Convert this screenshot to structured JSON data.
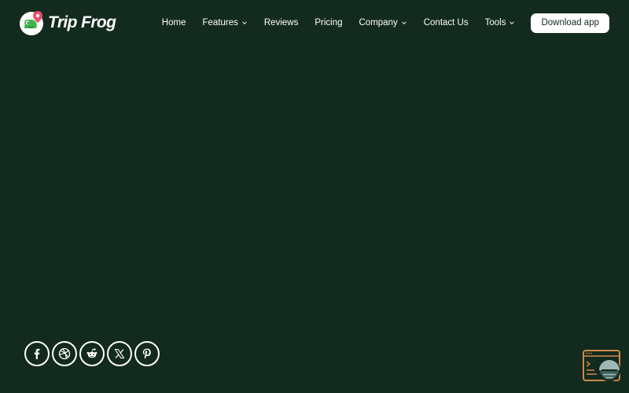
{
  "brand": {
    "name": "Trip Frog",
    "logo_icon": "frog-map-pin-icon",
    "accent_pin": "#e8506b",
    "frog_green": "#3bb54a"
  },
  "nav": {
    "items": [
      {
        "label": "Home",
        "has_dropdown": false
      },
      {
        "label": "Features",
        "has_dropdown": true,
        "icon": "chevron-down-icon"
      },
      {
        "label": "Reviews",
        "has_dropdown": false
      },
      {
        "label": "Pricing",
        "has_dropdown": false
      },
      {
        "label": "Company",
        "has_dropdown": true,
        "icon": "chevron-down-icon"
      },
      {
        "label": "Contact Us",
        "has_dropdown": false
      },
      {
        "label": "Tools",
        "has_dropdown": true,
        "icon": "chevron-down-icon"
      }
    ],
    "cta_label": "Download app"
  },
  "social": {
    "icons": [
      "facebook-icon",
      "dribbble-icon",
      "reddit-icon",
      "x-icon",
      "pinterest-icon"
    ]
  },
  "widget": {
    "icon": "terminal-window-icon",
    "accent": "#d08a48"
  },
  "colors": {
    "background": "#132a1f",
    "text": "#ffffff",
    "cta_bg": "#ffffff",
    "cta_text": "#132a1f"
  }
}
